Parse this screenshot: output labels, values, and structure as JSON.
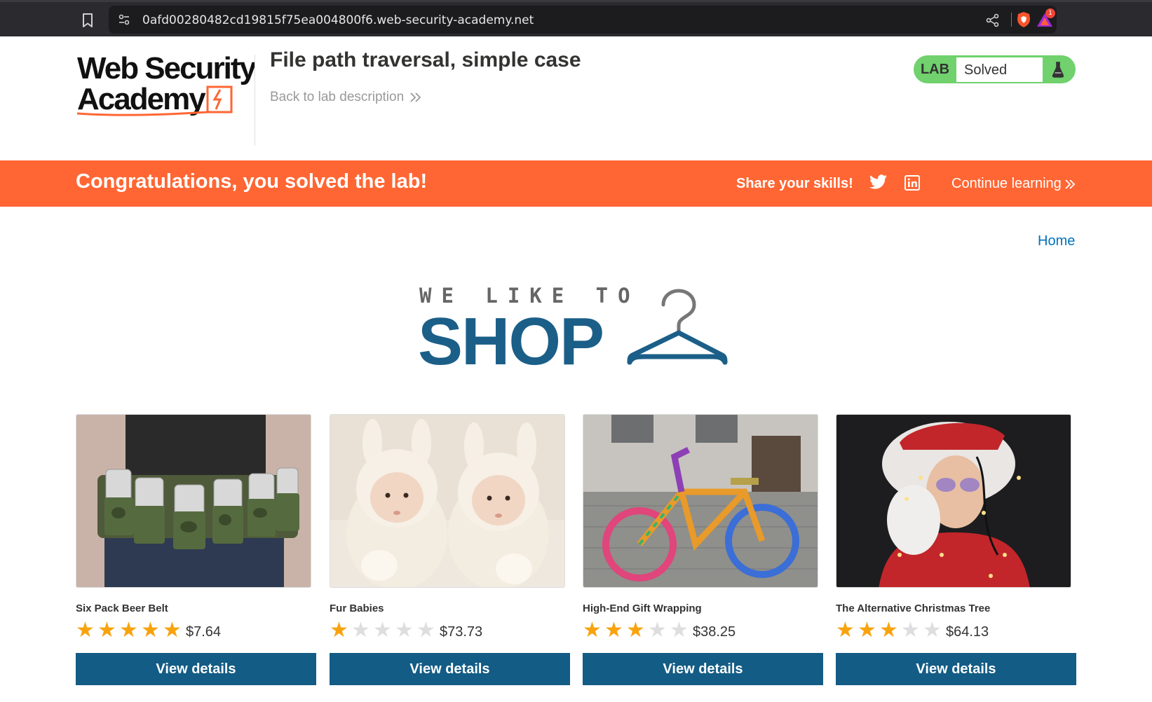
{
  "browser": {
    "url": "0afd00280482cd19815f75ea004800f6.web-security-academy.net",
    "rewards_badge": "1",
    "icons": [
      "bookmark-icon",
      "site-info-icon",
      "share-icon",
      "brave-shield-icon",
      "brave-rewards-icon"
    ]
  },
  "lab": {
    "logo_alt": "Web Security Academy",
    "title": "File path traversal, simple case",
    "back_link": "Back to lab description",
    "status_label": "LAB",
    "status_value": "Solved"
  },
  "banner": {
    "title": "Congratulations, you solved the lab!",
    "share_label": "Share your skills!",
    "continue_link": "Continue learning"
  },
  "nav": {
    "home": "Home"
  },
  "shop_logo": {
    "tagline": "WE LIKE TO",
    "word": "SHOP"
  },
  "products": [
    {
      "name": "Six Pack Beer Belt",
      "rating": 5,
      "price": "$7.64",
      "button": "View details"
    },
    {
      "name": "Fur Babies",
      "rating": 1,
      "price": "$73.73",
      "button": "View details"
    },
    {
      "name": "High-End Gift Wrapping",
      "rating": 3,
      "price": "$38.25",
      "button": "View details"
    },
    {
      "name": "The Alternative Christmas Tree",
      "rating": 3,
      "price": "$64.13",
      "button": "View details"
    }
  ],
  "colors": {
    "accent_orange": "#ff6633",
    "solved_green": "#70d16d",
    "button_blue": "#135c85",
    "star_gold": "#f8a30e",
    "link_blue": "#0071bc"
  }
}
